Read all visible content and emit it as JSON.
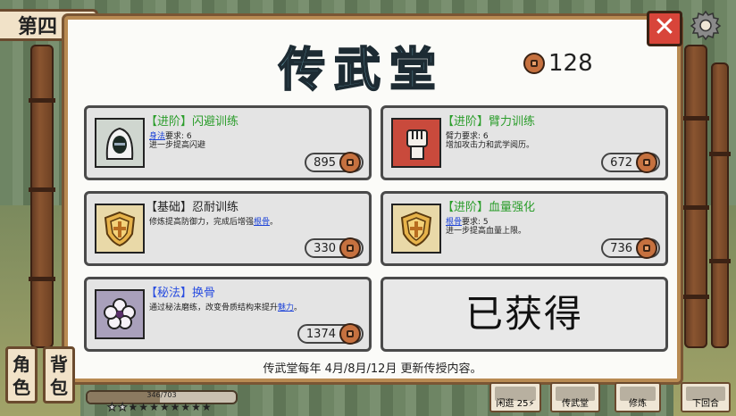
{
  "chapter": {
    "label": "第四"
  },
  "title": "传武堂",
  "coins": "128",
  "cards": [
    {
      "tag": "【进阶】",
      "name": "闪避训练",
      "tag_color": "#2b9d2b",
      "req_link": "身法",
      "req_text": "要求: 6",
      "desc": "进一步提高闪避",
      "desc_link": "",
      "desc_tail": "",
      "price": "895",
      "icon": "hooded-figure-icon"
    },
    {
      "tag": "【进阶】",
      "name": "臂力训练",
      "tag_color": "#2b9d2b",
      "req_link": "",
      "req_text": "臂力要求: 6",
      "desc": "增加攻击力和武学阅历。",
      "desc_link": "",
      "desc_tail": "",
      "price": "672",
      "icon": "fist-icon"
    },
    {
      "tag": "【基础】",
      "name": "忍耐训练",
      "tag_color": "#222222",
      "req_link": "",
      "req_text": "",
      "desc": "修炼提高防御力，完成后增强",
      "desc_link": "根骨",
      "desc_tail": "。",
      "price": "330",
      "icon": "shield-icon"
    },
    {
      "tag": "【进阶】",
      "name": "血量强化",
      "tag_color": "#2b9d2b",
      "req_link": "根骨",
      "req_text": "要求: 5",
      "desc": "进一步提高血量上限。",
      "desc_link": "",
      "desc_tail": "",
      "price": "736",
      "icon": "shield-icon"
    },
    {
      "tag": "【秘法】",
      "name": "换骨",
      "tag_color": "#2a4ee0",
      "req_link": "",
      "req_text": "",
      "desc": "通过秘法磨练，改变骨质结构来提升",
      "desc_link": "魅力",
      "desc_tail": "。",
      "price": "1374",
      "icon": "flower-icon"
    }
  ],
  "acquired_label": "已获得",
  "footer": "传武堂每年 4月/8月/12月 更新传授内容。",
  "side_buttons": [
    {
      "label": "角色"
    },
    {
      "label": "背包"
    }
  ],
  "exp": {
    "text": "346/703",
    "fraction": 0.49
  },
  "stars": {
    "filled": 8,
    "total": 10
  },
  "bottom_buttons": [
    {
      "label": "闲逛",
      "extra": "25⚡"
    },
    {
      "label": "传武堂"
    },
    {
      "label": "修炼"
    },
    {
      "label": "下回合"
    }
  ],
  "colors": {
    "title": "#88d0e4",
    "close": "#d8453a",
    "panel_border": "#b88a52",
    "coin": "#c6713f"
  }
}
